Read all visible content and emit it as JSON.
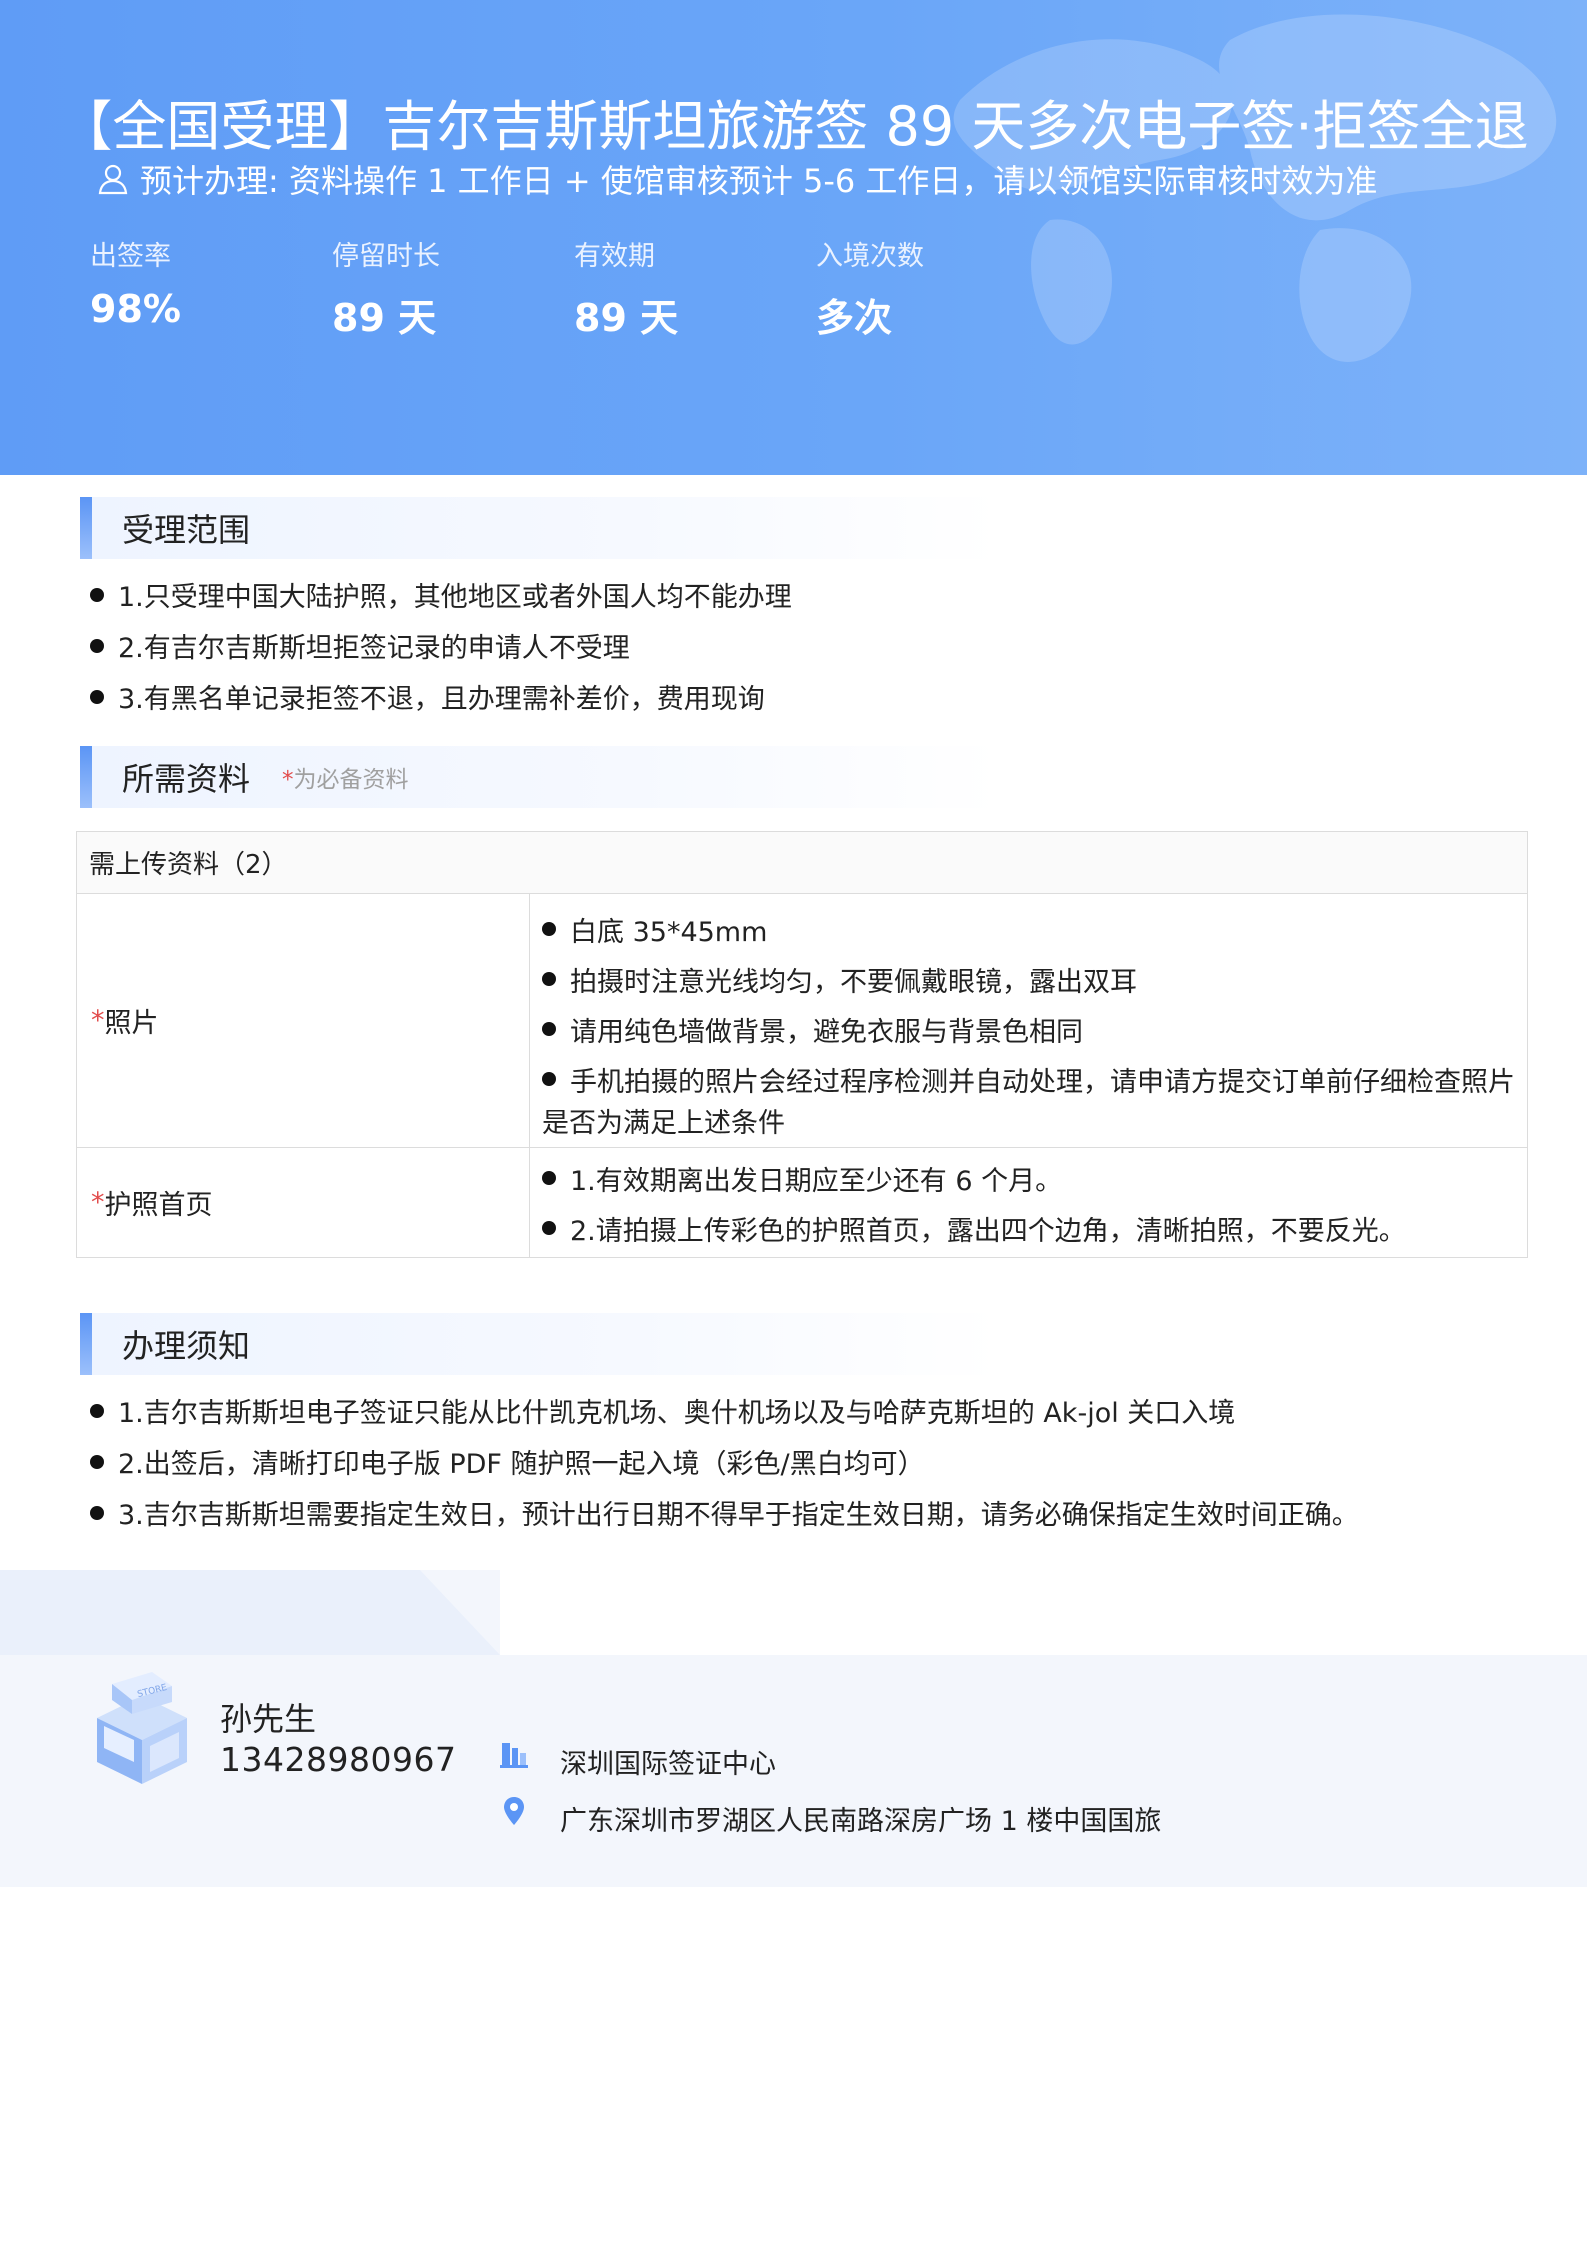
{
  "header": {
    "title": "【全国受理】吉尔吉斯斯坦旅游签 89 天多次电子签·拒签全退",
    "subtitle": "预计办理: 资料操作  1  工作日  +  使馆审核预计  5-6  工作日，请以领馆实际审核时效为准",
    "stats": [
      {
        "label": "出签率",
        "value": "98%"
      },
      {
        "label": "停留时长",
        "value": "89 天"
      },
      {
        "label": "有效期",
        "value": "89 天"
      },
      {
        "label": "入境次数",
        "value": "多次"
      }
    ]
  },
  "scope": {
    "title": "受理范围",
    "items": [
      "1.只受理中国大陆护照，其他地区或者外国人均不能办理",
      "2.有吉尔吉斯斯坦拒签记录的申请人不受理",
      "3.有黑名单记录拒签不退，且办理需补差价，费用现询"
    ]
  },
  "materials": {
    "title": "所需资料",
    "note_star": "*",
    "note": "为必备资料",
    "table_header": "需上传资料（2）",
    "rows": [
      {
        "star": "*",
        "name": "照片",
        "items": [
          "白底  35*45mm",
          "拍摄时注意光线均匀，不要佩戴眼镜，露出双耳",
          "请用纯色墙做背景，避免衣服与背景色相同",
          "手机拍摄的照片会经过程序检测并自动处理，请申请方提交订单前仔细检查照片"
        ],
        "continuation": "是否为满足上述条件"
      },
      {
        "star": "*",
        "name": "护照首页",
        "items": [
          "1.有效期离出发日期应至少还有 6 个月。",
          "2.请拍摄上传彩色的护照首页，露出四个边角，清晰拍照，不要反光。"
        ]
      }
    ]
  },
  "notice": {
    "title": "办理须知",
    "items": [
      "1.吉尔吉斯斯坦电子签证只能从比什凯克机场、奥什机场以及与哈萨克斯坦的 Ak-jol 关口入境",
      "2.出签后，清晰打印电子版 PDF 随护照一起入境（彩色/黑白均可）",
      "3.吉尔吉斯斯坦需要指定生效日，预计出行日期不得早于指定生效日期，请务必确保指定生效时间正确。"
    ]
  },
  "contact": {
    "store_sign": "STORE",
    "name": "孙先生",
    "phone": "13428980967",
    "organization": "深圳国际签证中心",
    "address": "广东深圳市罗湖区人民南路深房广场 1 楼中国国旅"
  },
  "colors": {
    "header_blue": "#6aa6f8",
    "accent_red": "#e24c4c"
  },
  "icons": [
    "user-icon",
    "building-icon",
    "location-pin-icon",
    "store-icon",
    "world-map-icon"
  ]
}
